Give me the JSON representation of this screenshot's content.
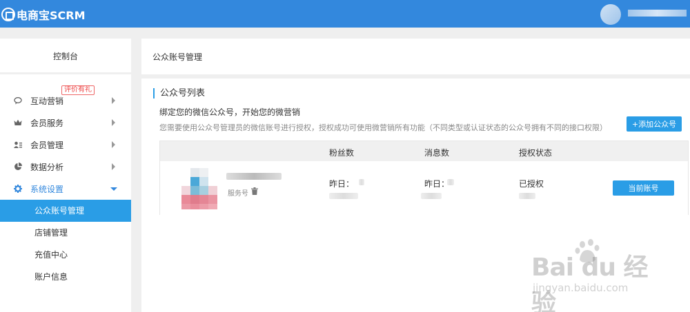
{
  "app": {
    "title": "电商宝SCRM"
  },
  "sidebar": {
    "header": "控制台",
    "items": [
      {
        "label": "互动营销",
        "icon": "chat-bubble-icon",
        "badge": "评价有礼"
      },
      {
        "label": "会员服务",
        "icon": "crown-icon"
      },
      {
        "label": "会员管理",
        "icon": "member-list-icon"
      },
      {
        "label": "数据分析",
        "icon": "pie-chart-icon"
      },
      {
        "label": "系统设置",
        "icon": "gear-icon"
      }
    ],
    "submenu": [
      {
        "label": "公众账号管理"
      },
      {
        "label": "店铺管理"
      },
      {
        "label": "充值中心"
      },
      {
        "label": "账户信息"
      }
    ]
  },
  "main": {
    "header_title": "公众账号管理",
    "panel_title": "公众号列表",
    "bind_text": "绑定您的微信公众号，开始您的微营销",
    "description": "您需要使用公众号管理员的微信账号进行授权，授权成功可使用微营销所有功能（不同类型或认证状态的公众号拥有不同的接口权限）",
    "add_button": "+添加公众号",
    "table": {
      "columns": [
        "粉丝数",
        "消息数",
        "授权状态"
      ],
      "rows": [
        {
          "account_type": "服务号",
          "fans_label": "昨日：",
          "messages_label": "昨日：",
          "auth_status": "已授权",
          "action": "当前账号"
        }
      ]
    }
  },
  "watermark": {
    "brand": "Bai du 经验",
    "url": "jingyan.baidu.com"
  },
  "colors": {
    "topbar": "#3388dd",
    "accent": "#2a9de6",
    "badge": "#e44444"
  }
}
